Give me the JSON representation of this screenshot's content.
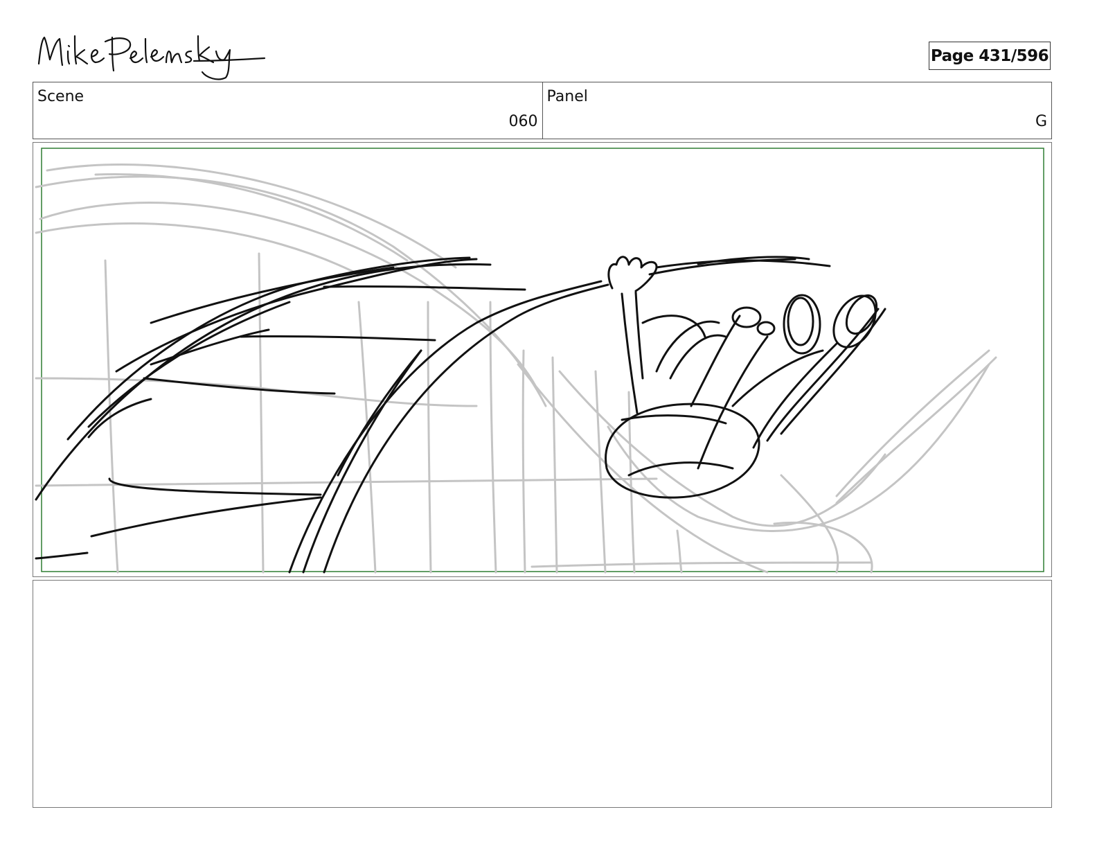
{
  "header": {
    "logo_alt": "Mike Pelensky",
    "page_label": "Page 431/596"
  },
  "scene": {
    "label": "Scene",
    "value": "060"
  },
  "panel": {
    "label": "Panel",
    "value": "G"
  },
  "notes": {
    "text": ""
  }
}
